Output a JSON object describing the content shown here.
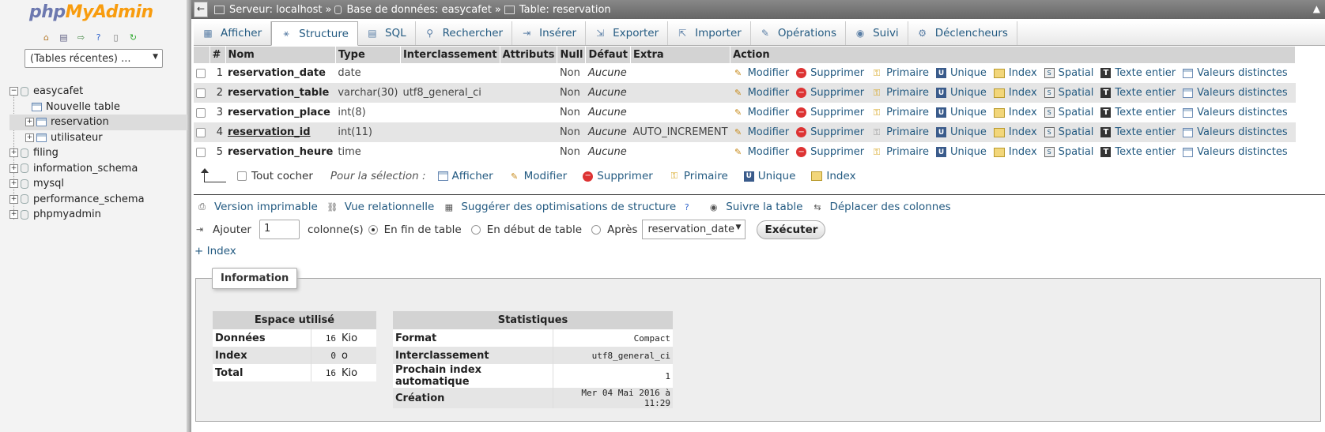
{
  "nav": {
    "logo_php": "php",
    "logo_myadmin": "MyAdmin",
    "recent_tables": "(Tables récentes) ...",
    "tree": [
      {
        "label": "easycafet",
        "type": "db",
        "expanded": true
      },
      {
        "label": "Nouvelle table",
        "type": "new"
      },
      {
        "label": "reservation",
        "type": "table",
        "selected": true
      },
      {
        "label": "utilisateur",
        "type": "table"
      },
      {
        "label": "filing",
        "type": "db"
      },
      {
        "label": "information_schema",
        "type": "db"
      },
      {
        "label": "mysql",
        "type": "db"
      },
      {
        "label": "performance_schema",
        "type": "db"
      },
      {
        "label": "phpmyadmin",
        "type": "db"
      }
    ]
  },
  "topbar": {
    "back": "←",
    "server": "Serveur: localhost",
    "sep1": "»",
    "database": "Base de données: easycafet",
    "sep2": "»",
    "table": "Table: reservation"
  },
  "tabs": [
    {
      "label": "Afficher",
      "icon": "browse-icon"
    },
    {
      "label": "Structure",
      "icon": "structure-icon",
      "active": true
    },
    {
      "label": "SQL",
      "icon": "sql-icon"
    },
    {
      "label": "Rechercher",
      "icon": "search-icon"
    },
    {
      "label": "Insérer",
      "icon": "insert-icon"
    },
    {
      "label": "Exporter",
      "icon": "export-icon"
    },
    {
      "label": "Importer",
      "icon": "import-icon"
    },
    {
      "label": "Opérations",
      "icon": "wrench-icon"
    },
    {
      "label": "Suivi",
      "icon": "eye-icon"
    },
    {
      "label": "Déclencheurs",
      "icon": "trigger-icon"
    }
  ],
  "structure": {
    "headers": [
      "#",
      "Nom",
      "Type",
      "Interclassement",
      "Attributs",
      "Null",
      "Défaut",
      "Extra",
      "Action"
    ],
    "rows": [
      {
        "num": "1",
        "name": "reservation_date",
        "type": "date",
        "collation": "",
        "attributes": "",
        "null": "Non",
        "default": "Aucune",
        "extra": "",
        "primary": false
      },
      {
        "num": "2",
        "name": "reservation_table",
        "type": "varchar(30)",
        "collation": "utf8_general_ci",
        "attributes": "",
        "null": "Non",
        "default": "Aucune",
        "extra": "",
        "primary": false
      },
      {
        "num": "3",
        "name": "reservation_place",
        "type": "int(8)",
        "collation": "",
        "attributes": "",
        "null": "Non",
        "default": "Aucune",
        "extra": "",
        "primary": false
      },
      {
        "num": "4",
        "name": "reservation_id",
        "type": "int(11)",
        "collation": "",
        "attributes": "",
        "null": "Non",
        "default": "Aucune",
        "extra": "AUTO_INCREMENT",
        "primary": true
      },
      {
        "num": "5",
        "name": "reservation_heure",
        "type": "time",
        "collation": "",
        "attributes": "",
        "null": "Non",
        "default": "Aucune",
        "extra": "",
        "primary": false
      }
    ],
    "actions": {
      "modify": "Modifier",
      "delete": "Supprimer",
      "primary": "Primaire",
      "unique": "Unique",
      "index": "Index",
      "spatial": "Spatial",
      "fulltext": "Texte entier",
      "distinct": "Valeurs distinctes"
    }
  },
  "selection": {
    "check_all": "Tout cocher",
    "for_selection": "Pour la sélection :",
    "actions": [
      "Afficher",
      "Modifier",
      "Supprimer",
      "Primaire",
      "Unique",
      "Index"
    ]
  },
  "links": {
    "print": "Version imprimable",
    "relational": "Vue relationnelle",
    "suggest": "Suggérer des optimisations de structure",
    "track": "Suivre la table",
    "move": "Déplacer des colonnes"
  },
  "add_columns": {
    "label": "Ajouter",
    "count": "1",
    "columns_label": "colonne(s)",
    "at_end": "En fin de table",
    "at_start": "En début de table",
    "after": "Après",
    "after_column": "reservation_date",
    "execute": "Exécuter"
  },
  "plus_index": "+ Index",
  "information": {
    "legend": "Information",
    "space": {
      "title": "Espace utilisé",
      "rows": [
        {
          "label": "Données",
          "value": "16",
          "unit": "Kio"
        },
        {
          "label": "Index",
          "value": "0",
          "unit": "o"
        },
        {
          "label": "Total",
          "value": "16",
          "unit": "Kio"
        }
      ]
    },
    "stats": {
      "title": "Statistiques",
      "rows": [
        {
          "label": "Format",
          "value": "Compact"
        },
        {
          "label": "Interclassement",
          "value": "utf8_general_ci"
        },
        {
          "label": "Prochain index automatique",
          "value": "1"
        },
        {
          "label": "Création",
          "value": "Mer 04 Mai 2016 à 11:29"
        }
      ]
    }
  },
  "colors": {
    "link": "#235a81",
    "header_bg": "#d3d3d3",
    "row_alt": "#e5e5e5",
    "topbar": "#777777"
  }
}
